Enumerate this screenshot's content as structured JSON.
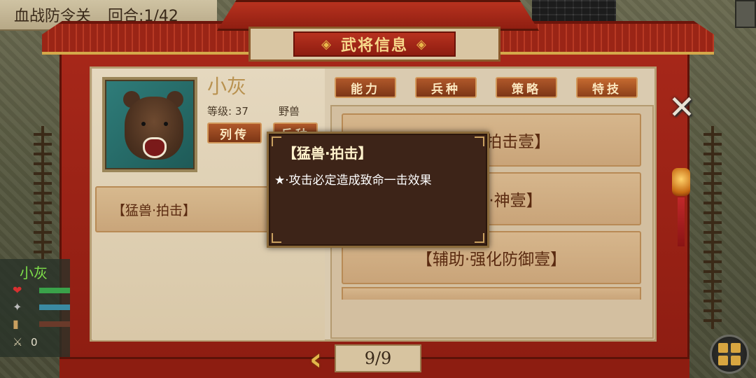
{
  "stage": {
    "name": "血战防令关",
    "round_label": "回合:",
    "round_value": "1/42"
  },
  "dialog": {
    "title": "武将信息",
    "tabs": [
      "能力",
      "兵种",
      "策略",
      "特技"
    ],
    "close_icon": "close-x-icon"
  },
  "hero": {
    "name": "小灰",
    "level_label": "等级:",
    "level_value": "37",
    "type": "野兽",
    "biography_button": "列传",
    "second_button": "兵种"
  },
  "skills_left": [
    "【猛兽·拍击】"
  ],
  "skills_right": [
    "【猛兽·拍击壹】",
    "【猛兽·神壹】",
    "【辅助·强化防御壹】"
  ],
  "tooltip": {
    "title": "【猛兽·拍击】",
    "description": "★·攻击必定造成致命一击效果"
  },
  "pager": {
    "current": "9/9"
  },
  "unit_status": {
    "name": "小灰",
    "hp_color": "#3aa24a",
    "mp_color": "#3a8aa2",
    "attack_value": "0"
  },
  "colors": {
    "frame_red": "#a8281a",
    "gold": "#e8b84a",
    "parchment": "#dacbb0"
  }
}
